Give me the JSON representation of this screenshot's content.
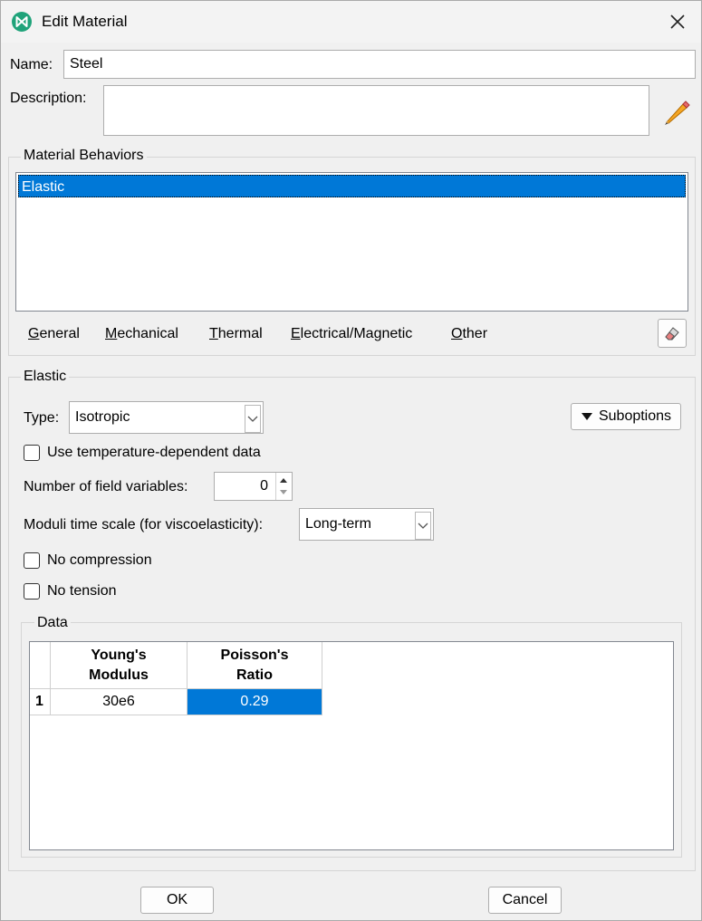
{
  "window": {
    "title": "Edit Material"
  },
  "name": {
    "label": "Name:",
    "value": "Steel"
  },
  "description": {
    "label": "Description:",
    "value": ""
  },
  "behaviors": {
    "title": "Material Behaviors",
    "items": [
      "Elastic"
    ],
    "menu": [
      {
        "mnemonic": "G",
        "rest": "eneral"
      },
      {
        "mnemonic": "M",
        "rest": "echanical"
      },
      {
        "mnemonic": "T",
        "rest": "hermal"
      },
      {
        "mnemonic": "E",
        "rest": "lectrical/Magnetic"
      },
      {
        "mnemonic": "O",
        "rest": "ther"
      }
    ]
  },
  "elastic": {
    "title": "Elastic",
    "type_label": "Type:",
    "type_value": "Isotropic",
    "suboptions_label": "Suboptions",
    "temp_dependent_label": "Use temperature-dependent data",
    "field_vars_label": "Number of field variables:",
    "field_vars_value": "0",
    "moduli_label": "Moduli time scale (for viscoelasticity):",
    "moduli_value": "Long-term",
    "no_compression_label": "No compression",
    "no_tension_label": "No tension"
  },
  "data": {
    "title": "Data",
    "columns": [
      {
        "line1": "Young's",
        "line2": "Modulus"
      },
      {
        "line1": "Poisson's",
        "line2": "Ratio"
      }
    ],
    "rows": [
      {
        "index": "1",
        "cells": [
          "30e6",
          "0.29"
        ]
      }
    ]
  },
  "buttons": {
    "ok": "OK",
    "cancel": "Cancel"
  },
  "colors": {
    "selection": "#0078d7",
    "app_icon": "#1fa37a"
  }
}
